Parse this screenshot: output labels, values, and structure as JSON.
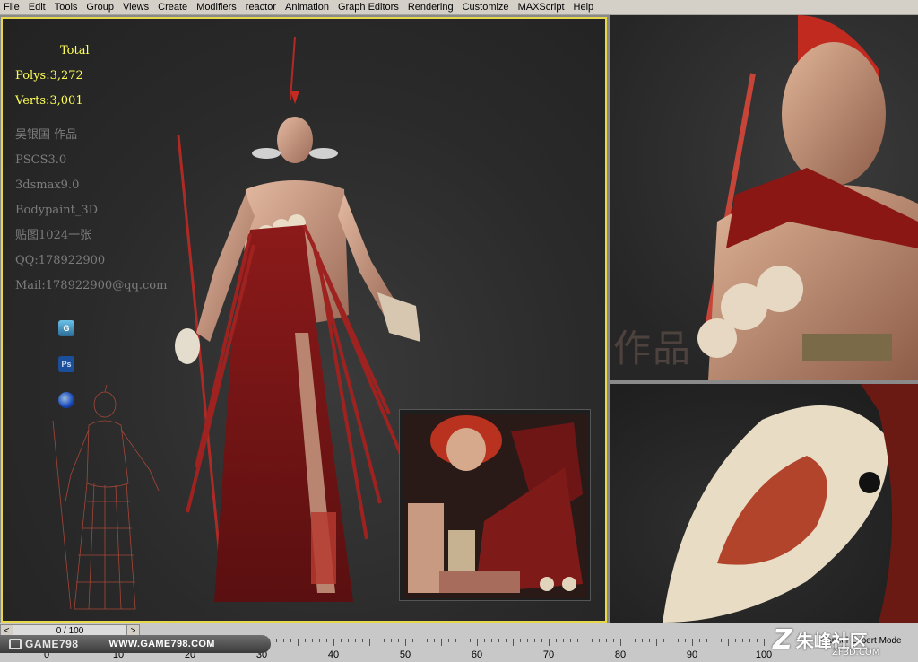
{
  "menubar": {
    "items": [
      "File",
      "Edit",
      "Tools",
      "Group",
      "Views",
      "Create",
      "Modifiers",
      "reactor",
      "Animation",
      "Graph Editors",
      "Rendering",
      "Customize",
      "MAXScript",
      "Help"
    ]
  },
  "viewport_main": {
    "stats": {
      "total_label": "Total",
      "polys": "Polys:3,272",
      "verts": "Verts:3,001"
    },
    "credits": [
      "吴银国 作品",
      "PSCS3.0",
      "3dsmax9.0",
      "Bodypaint_3D",
      "贴图1024一张",
      "QQ:178922900",
      "Mail:178922900@qq.com"
    ],
    "app_icons": [
      {
        "name": "gametex-icon",
        "glyph": "G"
      },
      {
        "name": "photoshop-icon",
        "glyph": "Ps"
      },
      {
        "name": "bodypaint-icon",
        "glyph": ""
      }
    ]
  },
  "viewport_top_right": {
    "watermark": "作品"
  },
  "timeline": {
    "slider_value": "0 / 100",
    "ticks": [
      "0",
      "10",
      "20",
      "30",
      "40",
      "50",
      "60",
      "70",
      "80",
      "90",
      "100"
    ],
    "logo_left": "GAME798",
    "logo_url": "WWW.GAME798.COM",
    "cancel_expert": "Cancel Expert Mode",
    "zf_mark": "Z",
    "zf_text": "朱峰社区",
    "zf_url": "ZF3D.COM"
  },
  "colors": {
    "active_viewport_border": "#e6d84a",
    "stats_text": "#ffff55",
    "credits_text": "#7c7c7c"
  }
}
